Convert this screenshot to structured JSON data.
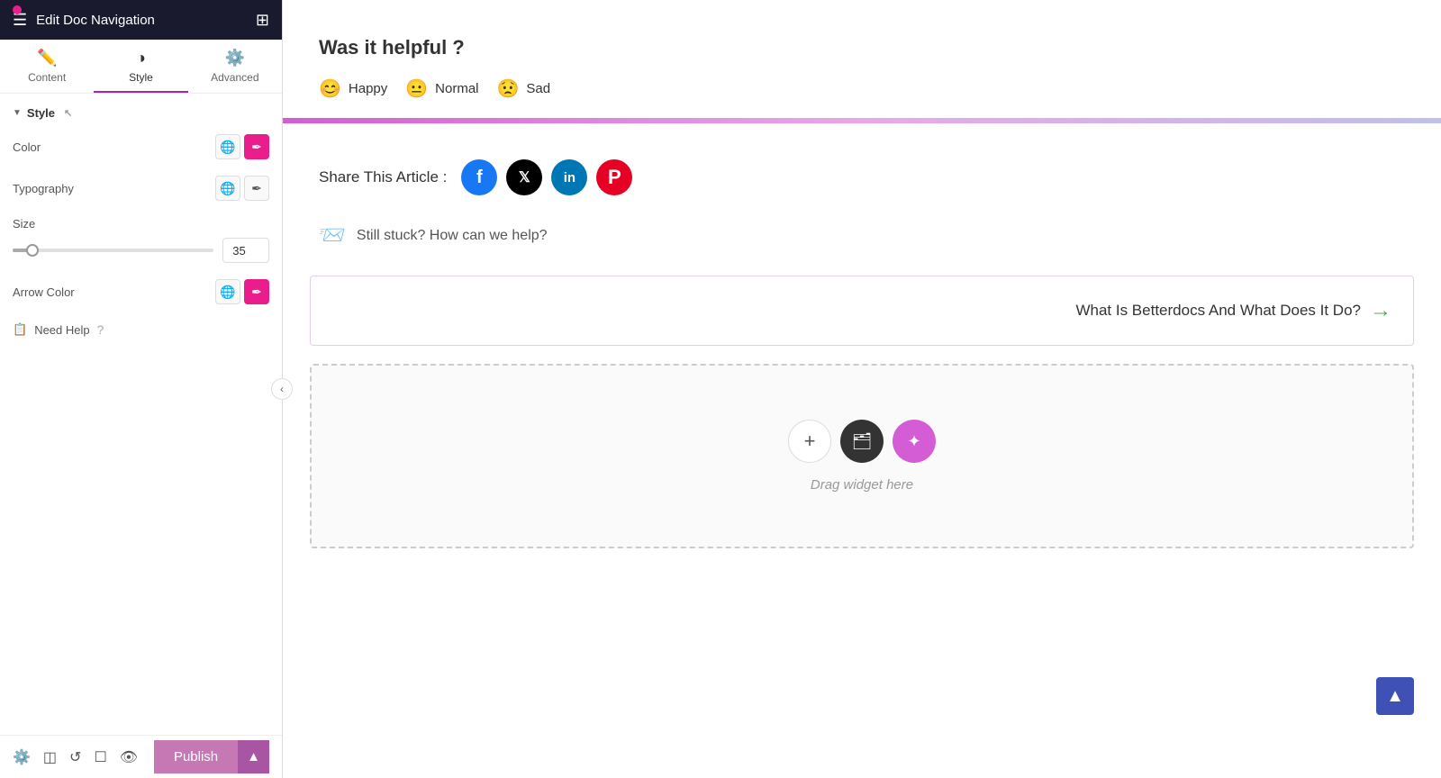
{
  "header": {
    "title": "Edit Doc Navigation",
    "menu_icon": "☰",
    "grid_icon": "⊞"
  },
  "tabs": [
    {
      "id": "content",
      "label": "Content",
      "icon": "✏️",
      "active": false
    },
    {
      "id": "style",
      "label": "Style",
      "icon": "◑",
      "active": true
    },
    {
      "id": "advanced",
      "label": "Advanced",
      "icon": "⚙️",
      "active": false
    }
  ],
  "sidebar": {
    "section": "Style",
    "controls": {
      "color_label": "Color",
      "typography_label": "Typography",
      "size_label": "Size",
      "size_value": "35",
      "arrow_color_label": "Arrow Color"
    },
    "need_help_label": "Need Help"
  },
  "bottom_bar": {
    "publish_label": "Publish"
  },
  "main": {
    "helpful_title": "Was it helpful ?",
    "emoji_items": [
      {
        "emoji": "😊",
        "label": "Happy"
      },
      {
        "emoji": "😐",
        "label": "Normal"
      },
      {
        "emoji": "😟",
        "label": "Sad"
      }
    ],
    "share_label": "Share This Article :",
    "social_links": [
      {
        "name": "facebook",
        "symbol": "f"
      },
      {
        "name": "twitter",
        "symbol": "𝕏"
      },
      {
        "name": "linkedin",
        "symbol": "in"
      },
      {
        "name": "pinterest",
        "symbol": "P"
      }
    ],
    "still_stuck_text": "Still stuck? How can we help?",
    "nav_next_title": "What Is Betterdocs And What Does It Do?",
    "drag_text": "Drag widget here"
  }
}
